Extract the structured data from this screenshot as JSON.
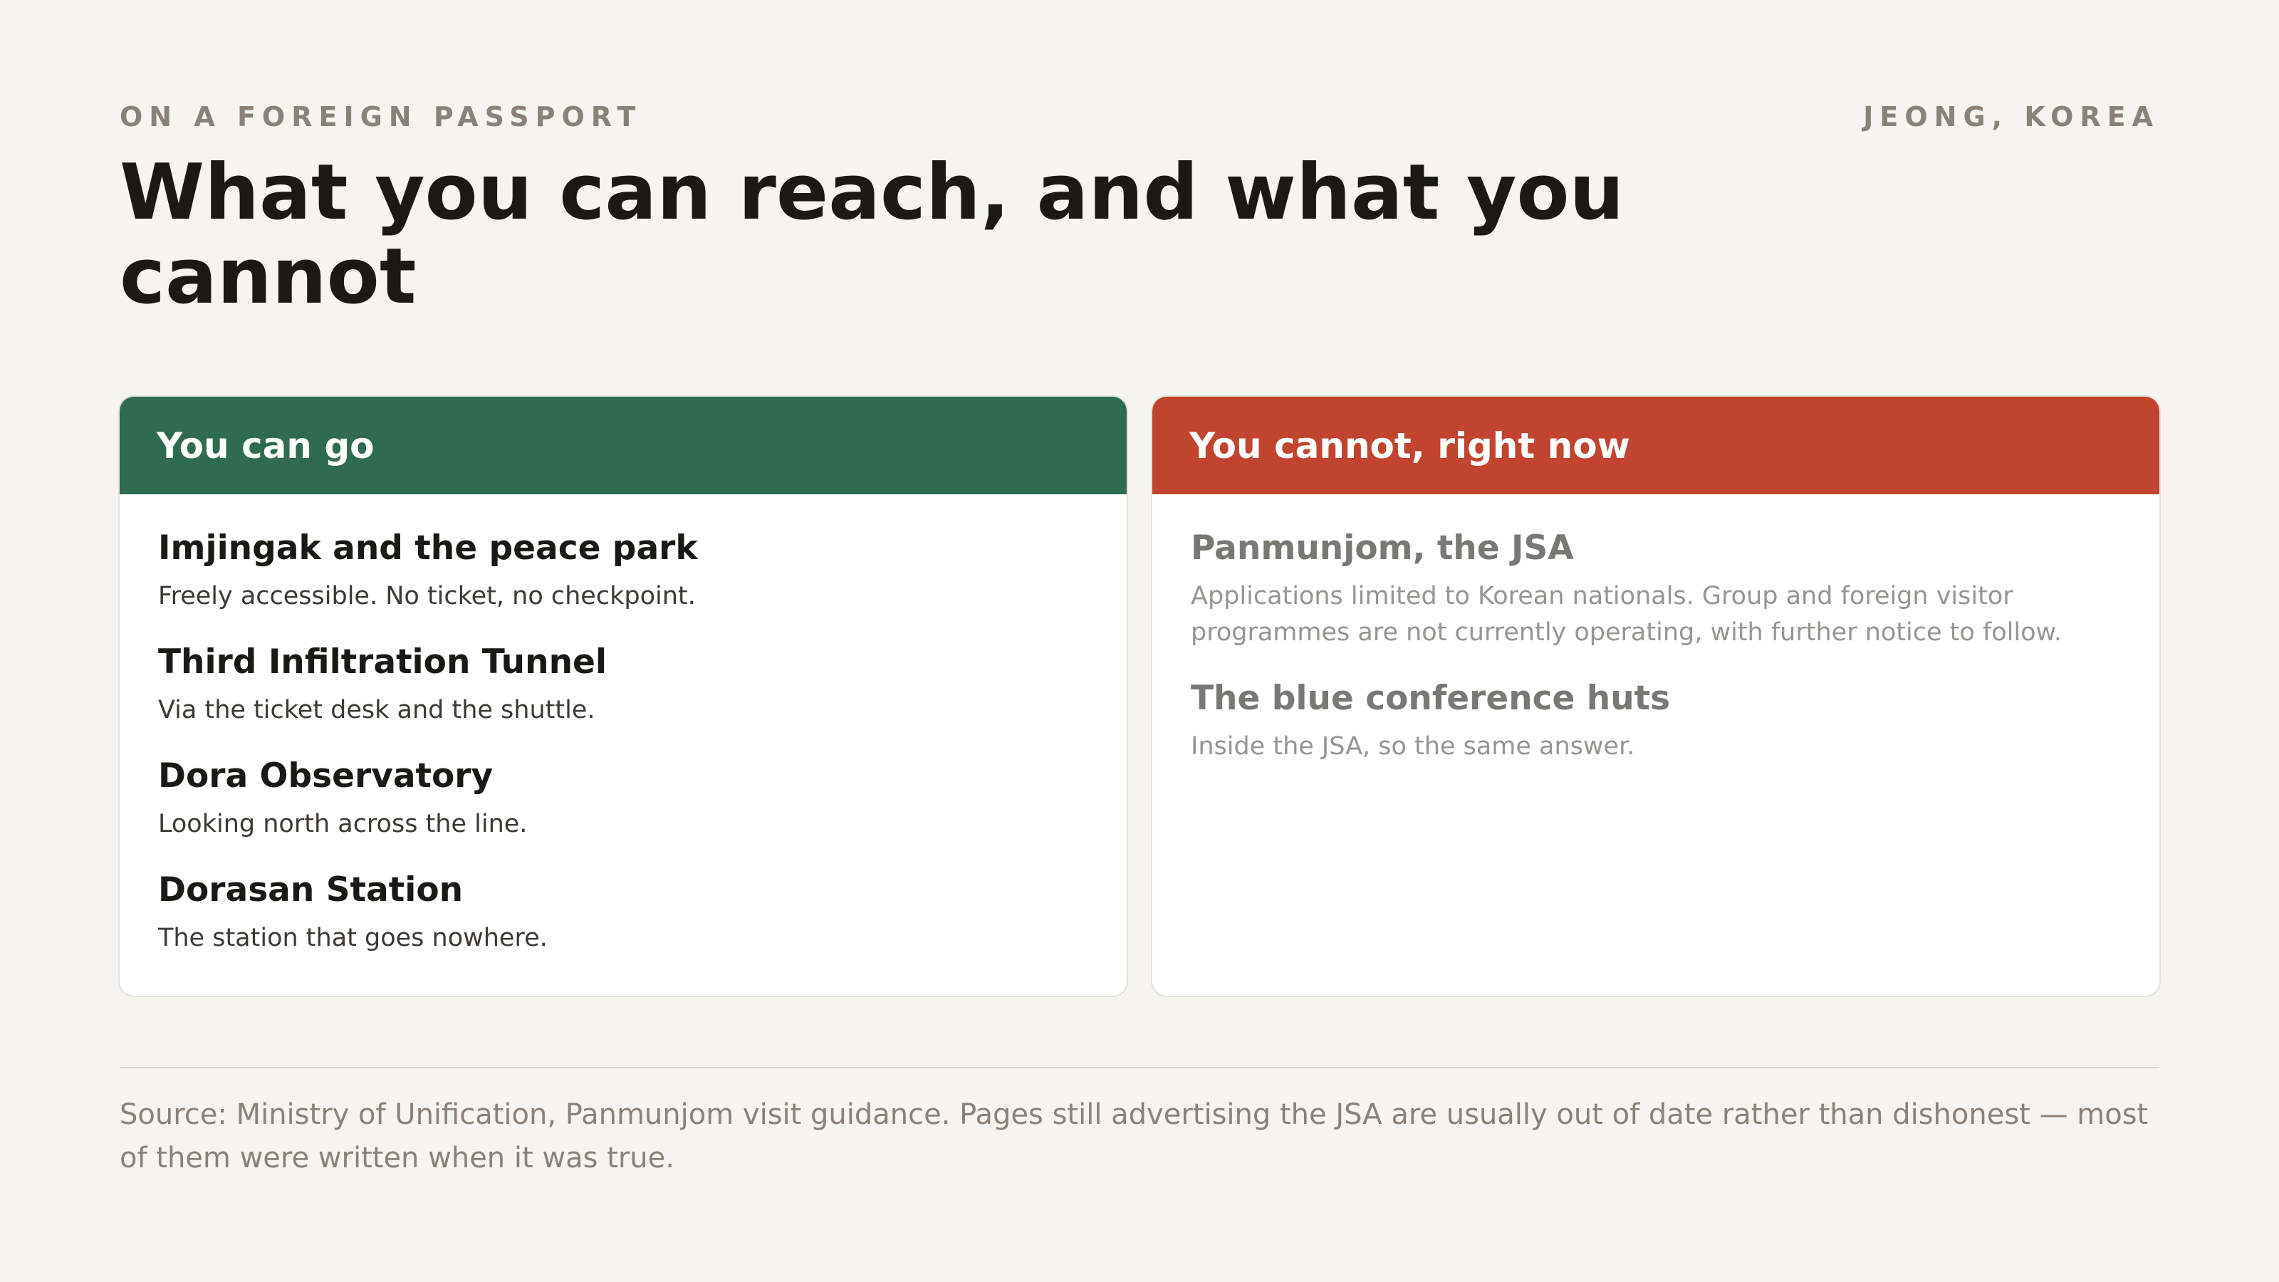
{
  "header": {
    "eyebrow": "ON A FOREIGN PASSPORT",
    "location": "JEONG, KOREA",
    "title": "What you can reach, and what you cannot"
  },
  "can_go": {
    "heading": "You can go",
    "accent_color": "#2f6b50",
    "items": [
      {
        "title": "Imjingak and the peace park",
        "desc": "Freely accessible. No ticket, no checkpoint."
      },
      {
        "title": "Third Infiltration Tunnel",
        "desc": "Via the ticket desk and the shuttle."
      },
      {
        "title": "Dora Observatory",
        "desc": "Looking north across the line."
      },
      {
        "title": "Dorasan Station",
        "desc": "The station that goes nowhere."
      }
    ]
  },
  "cannot_go": {
    "heading": "You cannot, right now",
    "accent_color": "#c1442f",
    "items": [
      {
        "title": "Panmunjom, the JSA",
        "desc": "Applications limited to Korean nationals. Group and foreign visitor programmes are not currently operating, with further notice to follow."
      },
      {
        "title": "The blue conference huts",
        "desc": "Inside the JSA, so the same answer."
      }
    ]
  },
  "footer": {
    "source": "Source: Ministry of Unification, Panmunjom visit guidance. Pages still advertising the JSA are usually out of date rather than dishonest — most of them were written when it was true."
  }
}
